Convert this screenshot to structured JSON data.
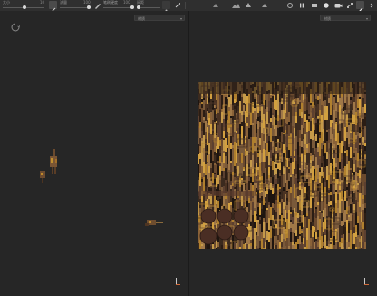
{
  "toolbar": {
    "size_label": "大小",
    "size_value": "10",
    "flow_label": "流量",
    "flow_value": "100",
    "hardness_label": "笔刷硬度",
    "hardness_value": "100",
    "spacing_label": "间距",
    "icons": [
      "brush-mode-icon",
      "cursor-icon",
      "eraser-icon",
      "layer-icon",
      "pen-icon",
      "mirror-icon",
      "snap-icon",
      "fill-icon",
      "pause-icon",
      "camera-icon",
      "record-icon",
      "settings-icon",
      "hierarchy-icon",
      "paint-icon"
    ]
  },
  "viewport_left": {
    "view_mode": "材质"
  },
  "viewport_right": {
    "view_mode": "材质"
  },
  "colors": {
    "background": "#262626",
    "toolbar": "#2f2f2f",
    "texture_base": "#3a2a1f",
    "texture_accent": "#c08a2a",
    "axis_x": "#d06b3a",
    "axis_y": "#c8c8c8"
  }
}
